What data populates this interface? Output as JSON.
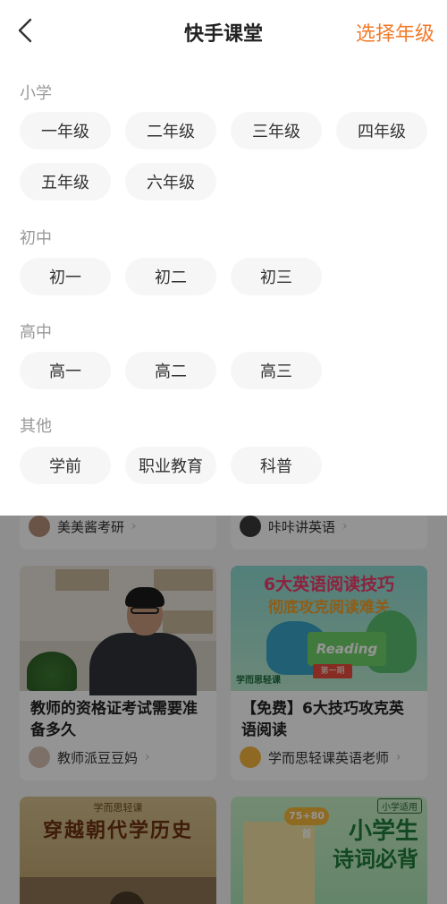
{
  "header": {
    "title": "快手课堂",
    "action_label": "选择年级",
    "back_icon": "chevron-left-icon"
  },
  "grade_picker": {
    "sections": [
      {
        "label": "小学",
        "grades": [
          "一年级",
          "二年级",
          "三年级",
          "四年级",
          "五年级",
          "六年级"
        ]
      },
      {
        "label": "初中",
        "grades": [
          "初一",
          "初二",
          "初三"
        ]
      },
      {
        "label": "高中",
        "grades": [
          "高一",
          "高二",
          "高三"
        ]
      },
      {
        "label": "其他",
        "grades": [
          "学前",
          "职业教育",
          "科普"
        ]
      }
    ]
  },
  "feed": {
    "top_authors": [
      "美美酱考研",
      "咔咔讲英语"
    ],
    "cards": [
      {
        "title": "教师的资格证考试需要准备多久",
        "author": "教师派豆豆妈"
      },
      {
        "title": "【免费】6大技巧攻克英语阅读",
        "author": "学而思轻课英语老师",
        "thumb_text": {
          "line1": "6大英语阅读技巧",
          "line2": "彻底攻克阅读难关",
          "book": "Reading",
          "ribbon": "第一期",
          "brand": "学而思轻课"
        }
      },
      {
        "thumb_text": {
          "brand": "学而思轻课",
          "headline": "穿越朝代学历史"
        }
      },
      {
        "thumb_text": {
          "tag": "小学适用",
          "line1": "小学生",
          "line2": "诗词必背",
          "badge": "75+80首"
        }
      }
    ]
  },
  "colors": {
    "accent": "#f27b2b",
    "chip_bg": "#f6f6f6",
    "section_label": "#999999",
    "overlay": "rgba(0,0,0,0.42)"
  }
}
